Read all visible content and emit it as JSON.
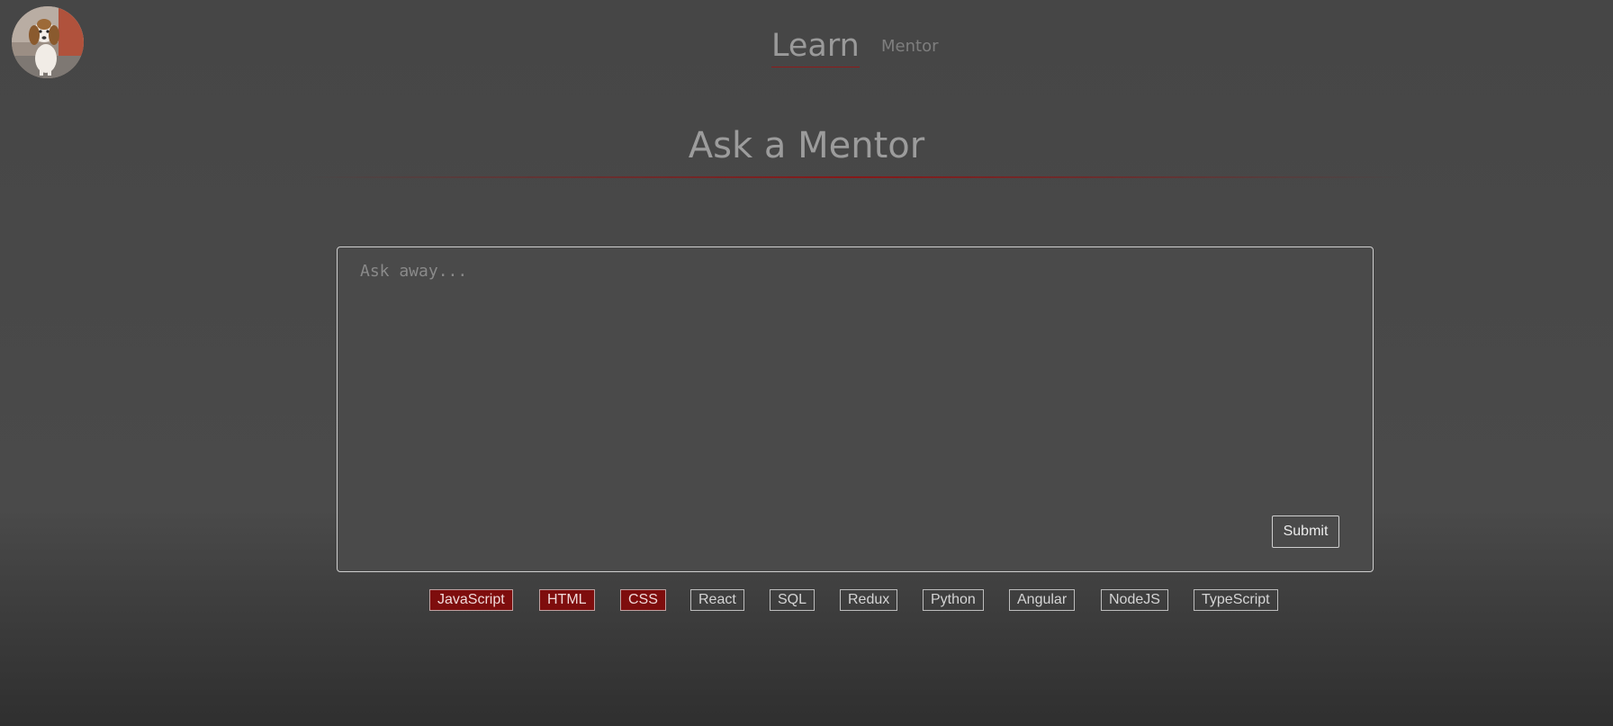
{
  "nav": {
    "learn_label": "Learn",
    "mentor_label": "Mentor"
  },
  "page": {
    "title": "Ask a Mentor"
  },
  "question": {
    "placeholder": "Ask away...",
    "value": "",
    "submit_label": "Submit"
  },
  "tags": [
    {
      "label": "JavaScript",
      "selected": true
    },
    {
      "label": "HTML",
      "selected": true
    },
    {
      "label": "CSS",
      "selected": true
    },
    {
      "label": "React",
      "selected": false
    },
    {
      "label": "SQL",
      "selected": false
    },
    {
      "label": "Redux",
      "selected": false
    },
    {
      "label": "Python",
      "selected": false
    },
    {
      "label": "Angular",
      "selected": false
    },
    {
      "label": "NodeJS",
      "selected": false
    },
    {
      "label": "TypeScript",
      "selected": false
    }
  ],
  "colors": {
    "accent": "#7e0d0d",
    "background": "#4a4a4a",
    "text_muted": "#9a9a9a"
  },
  "icons": {
    "avatar": "user-avatar-puppy"
  }
}
